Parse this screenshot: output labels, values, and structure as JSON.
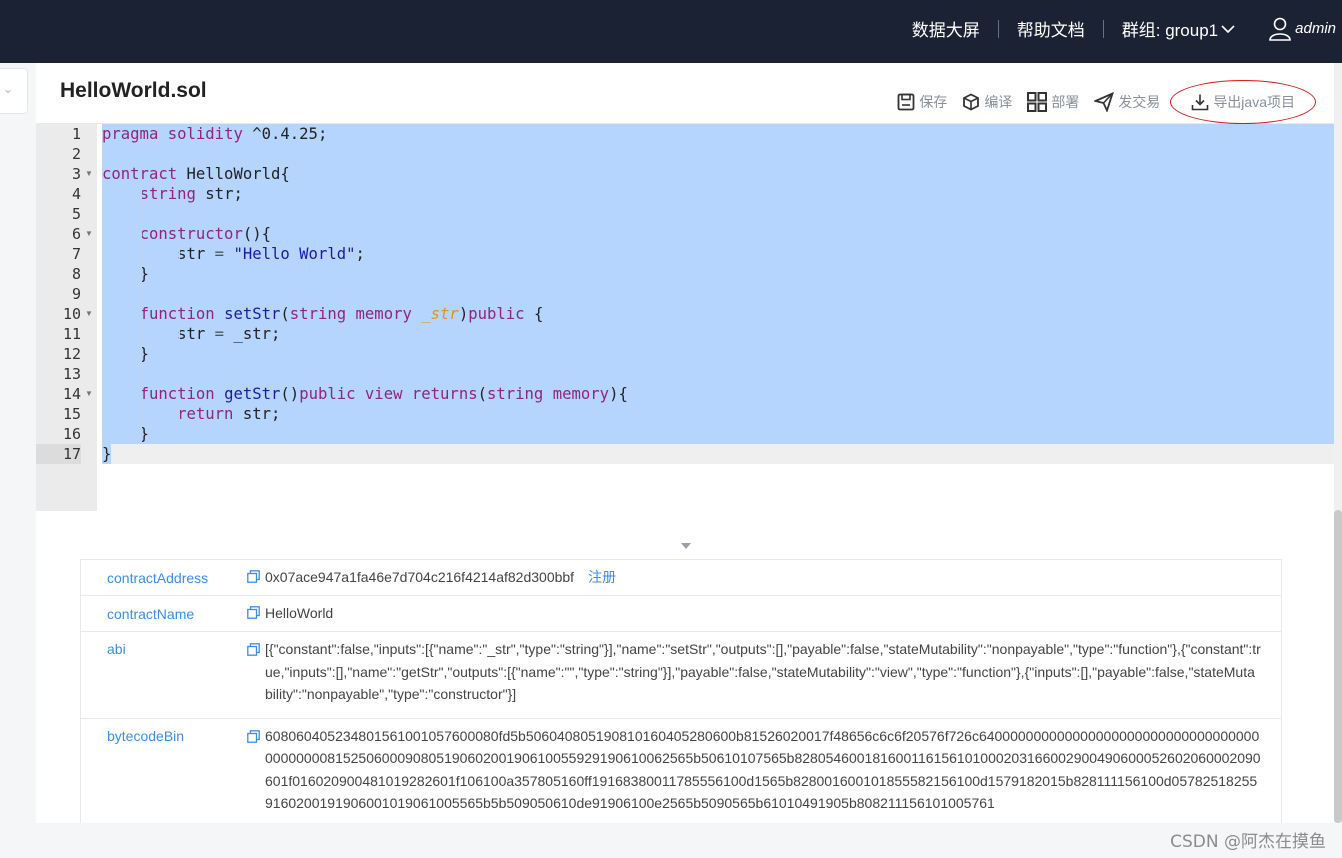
{
  "header": {
    "nav": [
      "数据大屏",
      "帮助文档"
    ],
    "group_label": "群组: group1",
    "user": "admin"
  },
  "file": {
    "name": "HelloWorld.sol"
  },
  "toolbar": {
    "save": "保存",
    "compile": "编译",
    "deploy": "部署",
    "send_tx": "发交易",
    "export_java": "导出java项目"
  },
  "editor": {
    "lines": [
      "pragma solidity ^0.4.25;",
      "",
      "contract HelloWorld{",
      "    string str;",
      "",
      "    constructor(){",
      "        str = \"Hello World\";",
      "    }",
      "",
      "    function setStr(string memory _str)public {",
      "        str = _str;",
      "    }",
      "",
      "    function getStr()public view returns(string memory){",
      "        return str;",
      "    }",
      "}"
    ],
    "line_numbers": [
      "1",
      "2",
      "3",
      "4",
      "5",
      "6",
      "7",
      "8",
      "9",
      "10",
      "11",
      "12",
      "13",
      "14",
      "15",
      "16",
      "17"
    ]
  },
  "contract_info": {
    "address_label": "contractAddress",
    "address": "0x07ace947a1fa46e7d704c216f4214af82d300bbf",
    "register_link": "注册",
    "name_label": "contractName",
    "name": "HelloWorld",
    "abi_label": "abi",
    "abi": "[{\"constant\":false,\"inputs\":[{\"name\":\"_str\",\"type\":\"string\"}],\"name\":\"setStr\",\"outputs\":[],\"payable\":false,\"stateMutability\":\"nonpayable\",\"type\":\"function\"},{\"constant\":true,\"inputs\":[],\"name\":\"getStr\",\"outputs\":[{\"name\":\"\",\"type\":\"string\"}],\"payable\":false,\"stateMutability\":\"view\",\"type\":\"function\"},{\"inputs\":[],\"payable\":false,\"stateMutability\":\"nonpayable\",\"type\":\"constructor\"}]",
    "bytecode_label": "bytecodeBin",
    "bytecode": "608060405234801561001057600080fd5b506040805190810160405280600b81526020017f48656c6c6f20576f726c6400000000000000000000000000000000000000000081525060009080519060200190610055929190610062565b50610107565b828054600181600116156101000203166002900490600052602060002090601f016020900481019282601f106100a357805160ff19168380011785556100d1565b828001600101855582156100d1579182015b828111156100d057825182559160200191906001019061005565b5b509050610de91906100e2565b5090565b61010491905b808211156101005761"
  },
  "watermark": "CSDN @阿杰在摸鱼"
}
